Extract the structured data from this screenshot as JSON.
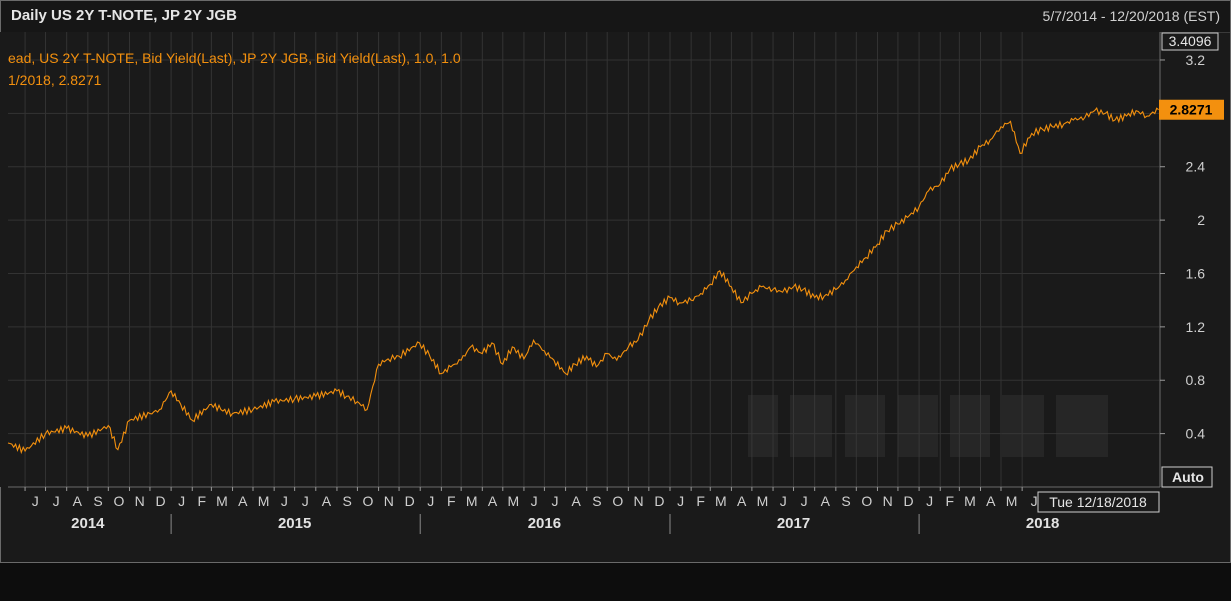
{
  "header": {
    "title": "Daily US 2Y T-NOTE, JP 2Y JGB",
    "date_range": "5/7/2014 - 12/20/2018 (EST)"
  },
  "legend": {
    "line1": "ead, US 2Y T-NOTE, Bid Yield(Last), JP 2Y JGB, Bid Yield(Last),  1.0, 1.0",
    "line2": "1/2018, 2.8271"
  },
  "y_axis": {
    "top_value_label": "3.4096",
    "last_value_label": "2.8271",
    "auto_label": "Auto",
    "ticks": [
      "3.2",
      "2.8",
      "2.4",
      "2",
      "1.6",
      "1.2",
      "0.8",
      "0.4"
    ]
  },
  "x_axis": {
    "cursor_label": "Tue 12/18/2018",
    "month_labels": [
      {
        "label": "J",
        "date": "2014-06-01"
      },
      {
        "label": "J",
        "date": "2014-07-01"
      },
      {
        "label": "A",
        "date": "2014-08-01"
      },
      {
        "label": "S",
        "date": "2014-09-01"
      },
      {
        "label": "O",
        "date": "2014-10-01"
      },
      {
        "label": "N",
        "date": "2014-11-01"
      },
      {
        "label": "D",
        "date": "2014-12-01"
      },
      {
        "label": "J",
        "date": "2015-01-01"
      },
      {
        "label": "F",
        "date": "2015-02-01"
      },
      {
        "label": "M",
        "date": "2015-03-01"
      },
      {
        "label": "A",
        "date": "2015-04-01"
      },
      {
        "label": "M",
        "date": "2015-05-01"
      },
      {
        "label": "J",
        "date": "2015-06-01"
      },
      {
        "label": "J",
        "date": "2015-07-01"
      },
      {
        "label": "A",
        "date": "2015-08-01"
      },
      {
        "label": "S",
        "date": "2015-09-01"
      },
      {
        "label": "O",
        "date": "2015-10-01"
      },
      {
        "label": "N",
        "date": "2015-11-01"
      },
      {
        "label": "D",
        "date": "2015-12-01"
      },
      {
        "label": "J",
        "date": "2016-01-01"
      },
      {
        "label": "F",
        "date": "2016-02-01"
      },
      {
        "label": "M",
        "date": "2016-03-01"
      },
      {
        "label": "A",
        "date": "2016-04-01"
      },
      {
        "label": "M",
        "date": "2016-05-01"
      },
      {
        "label": "J",
        "date": "2016-06-01"
      },
      {
        "label": "J",
        "date": "2016-07-01"
      },
      {
        "label": "A",
        "date": "2016-08-01"
      },
      {
        "label": "S",
        "date": "2016-09-01"
      },
      {
        "label": "O",
        "date": "2016-10-01"
      },
      {
        "label": "N",
        "date": "2016-11-01"
      },
      {
        "label": "D",
        "date": "2016-12-01"
      },
      {
        "label": "J",
        "date": "2017-01-01"
      },
      {
        "label": "F",
        "date": "2017-02-01"
      },
      {
        "label": "M",
        "date": "2017-03-01"
      },
      {
        "label": "A",
        "date": "2017-04-01"
      },
      {
        "label": "M",
        "date": "2017-05-01"
      },
      {
        "label": "J",
        "date": "2017-06-01"
      },
      {
        "label": "J",
        "date": "2017-07-01"
      },
      {
        "label": "A",
        "date": "2017-08-01"
      },
      {
        "label": "S",
        "date": "2017-09-01"
      },
      {
        "label": "O",
        "date": "2017-10-01"
      },
      {
        "label": "N",
        "date": "2017-11-01"
      },
      {
        "label": "D",
        "date": "2017-12-01"
      },
      {
        "label": "J",
        "date": "2018-01-01"
      },
      {
        "label": "F",
        "date": "2018-02-01"
      },
      {
        "label": "M",
        "date": "2018-03-01"
      },
      {
        "label": "A",
        "date": "2018-04-01"
      },
      {
        "label": "M",
        "date": "2018-05-01"
      },
      {
        "label": "J",
        "date": "2018-06-01"
      }
    ],
    "year_labels": [
      {
        "label": "2014",
        "date": "2014-09-01"
      },
      {
        "label": "2015",
        "date": "2015-07-01"
      },
      {
        "label": "2016",
        "date": "2016-07-01"
      },
      {
        "label": "2017",
        "date": "2017-07-01"
      },
      {
        "label": "2018",
        "date": "2018-07-01"
      }
    ]
  },
  "colors": {
    "line": "#f3900e",
    "background": "#1a1a1a",
    "grid": "#333333",
    "axis_text": "#cfcfcf"
  },
  "chart_data": {
    "type": "line",
    "title": "Daily US 2Y T-NOTE, JP 2Y JGB",
    "xlabel": "",
    "ylabel": "",
    "xlim": [
      "2014-05-07",
      "2018-12-20"
    ],
    "ylim": [
      0.0,
      3.4096
    ],
    "grid": true,
    "legend_position": "top-left",
    "series": [
      {
        "x": [
          "2014-05-07",
          "2014-06-01",
          "2014-07-01",
          "2014-08-01",
          "2014-09-01",
          "2014-10-01",
          "2014-10-15",
          "2014-11-01",
          "2014-12-01",
          "2014-12-15",
          "2015-01-01",
          "2015-01-15",
          "2015-02-01",
          "2015-03-01",
          "2015-03-15",
          "2015-04-01",
          "2015-05-01",
          "2015-06-01",
          "2015-07-01",
          "2015-08-01",
          "2015-09-01",
          "2015-09-15",
          "2015-10-01",
          "2015-10-15",
          "2015-11-01",
          "2015-11-15",
          "2015-12-01",
          "2015-12-31",
          "2016-01-15",
          "2016-02-01",
          "2016-02-15",
          "2016-03-01",
          "2016-03-15",
          "2016-04-01",
          "2016-04-15",
          "2016-05-01",
          "2016-05-15",
          "2016-06-01",
          "2016-06-15",
          "2016-07-01",
          "2016-07-15",
          "2016-08-01",
          "2016-08-15",
          "2016-09-01",
          "2016-09-15",
          "2016-10-01",
          "2016-10-15",
          "2016-11-01",
          "2016-11-15",
          "2016-12-01",
          "2016-12-15",
          "2017-01-01",
          "2017-01-15",
          "2017-02-01",
          "2017-02-15",
          "2017-03-01",
          "2017-03-15",
          "2017-04-01",
          "2017-04-15",
          "2017-05-01",
          "2017-05-15",
          "2017-06-01",
          "2017-06-15",
          "2017-07-01",
          "2017-07-15",
          "2017-08-01",
          "2017-08-15",
          "2017-09-01",
          "2017-09-15",
          "2017-10-01",
          "2017-10-15",
          "2017-11-01",
          "2017-11-15",
          "2017-12-01",
          "2017-12-15",
          "2018-01-01",
          "2018-01-15",
          "2018-02-01",
          "2018-02-15",
          "2018-03-01",
          "2018-03-15",
          "2018-04-01",
          "2018-04-15",
          "2018-05-01",
          "2018-05-15",
          "2018-05-29",
          "2018-06-15",
          "2018-07-01",
          "2018-07-15",
          "2018-08-01",
          "2018-08-15",
          "2018-09-01",
          "2018-09-15",
          "2018-10-01",
          "2018-10-15",
          "2018-11-01",
          "2018-11-15",
          "2018-12-01",
          "2018-12-18"
        ],
        "y": [
          0.33,
          0.27,
          0.4,
          0.44,
          0.38,
          0.46,
          0.28,
          0.5,
          0.55,
          0.58,
          0.72,
          0.62,
          0.5,
          0.62,
          0.58,
          0.55,
          0.58,
          0.64,
          0.66,
          0.68,
          0.72,
          0.68,
          0.64,
          0.58,
          0.92,
          0.96,
          0.98,
          1.08,
          0.98,
          0.85,
          0.9,
          0.95,
          1.05,
          1.0,
          1.08,
          0.92,
          1.05,
          0.96,
          1.1,
          1.02,
          0.95,
          0.85,
          0.92,
          0.98,
          0.9,
          1.0,
          0.95,
          1.05,
          1.1,
          1.25,
          1.35,
          1.42,
          1.38,
          1.4,
          1.45,
          1.52,
          1.62,
          1.5,
          1.38,
          1.45,
          1.5,
          1.48,
          1.46,
          1.5,
          1.48,
          1.42,
          1.43,
          1.48,
          1.55,
          1.65,
          1.72,
          1.82,
          1.92,
          1.97,
          2.02,
          2.1,
          2.22,
          2.27,
          2.38,
          2.42,
          2.45,
          2.55,
          2.6,
          2.7,
          2.74,
          2.5,
          2.65,
          2.68,
          2.7,
          2.72,
          2.75,
          2.77,
          2.82,
          2.8,
          2.75,
          2.78,
          2.82,
          2.78,
          2.8271
        ]
      }
    ],
    "last_value": 2.8271,
    "top_value": 3.4096
  }
}
